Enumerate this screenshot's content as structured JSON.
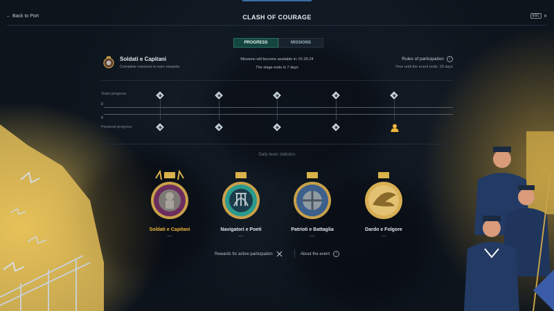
{
  "header": {
    "back_label": "Back to Port",
    "title": "CLASH OF COURAGE",
    "esc_key": "ESC",
    "close_glyph": "✕"
  },
  "tabs": [
    {
      "label": "PROGRESS",
      "active": true
    },
    {
      "label": "MISSIONS",
      "active": false
    }
  ],
  "event": {
    "team_name": "Soldati e Capitani",
    "team_subtitle": "Complete missions to earn rewards",
    "missions_available": "Missions will become available in: 01:25:24",
    "stage_ends": "The stage ends in 7 days",
    "rules_label": "Rules of participation",
    "time_left": "Time until the event ends: 28 days"
  },
  "progress": {
    "team_label": "Team progress",
    "personal_label": "Personal progress",
    "team_value": "0",
    "personal_value": "0",
    "milestones": 5
  },
  "stats": {
    "title": "Daily team statistics",
    "teams": [
      {
        "name": "Soldati e Capitani",
        "value": "—",
        "selected": true
      },
      {
        "name": "Navigatori e Poeti",
        "value": "—",
        "selected": false
      },
      {
        "name": "Patrioti e Battaglia",
        "value": "—",
        "selected": false
      },
      {
        "name": "Dardo e Folgore",
        "value": "—",
        "selected": false
      }
    ]
  },
  "footer": {
    "rewards_label": "Rewards for active participation",
    "about_label": "About the event"
  },
  "colors": {
    "accent_selected": "#f0b73c",
    "tab_active": "#13463e",
    "background": "#101820"
  },
  "icons": [
    "back-arrow-icon",
    "info-icon",
    "diamond-milestone-icon",
    "person-icon",
    "crossed-swords-icon",
    "team-emblem-icon"
  ]
}
